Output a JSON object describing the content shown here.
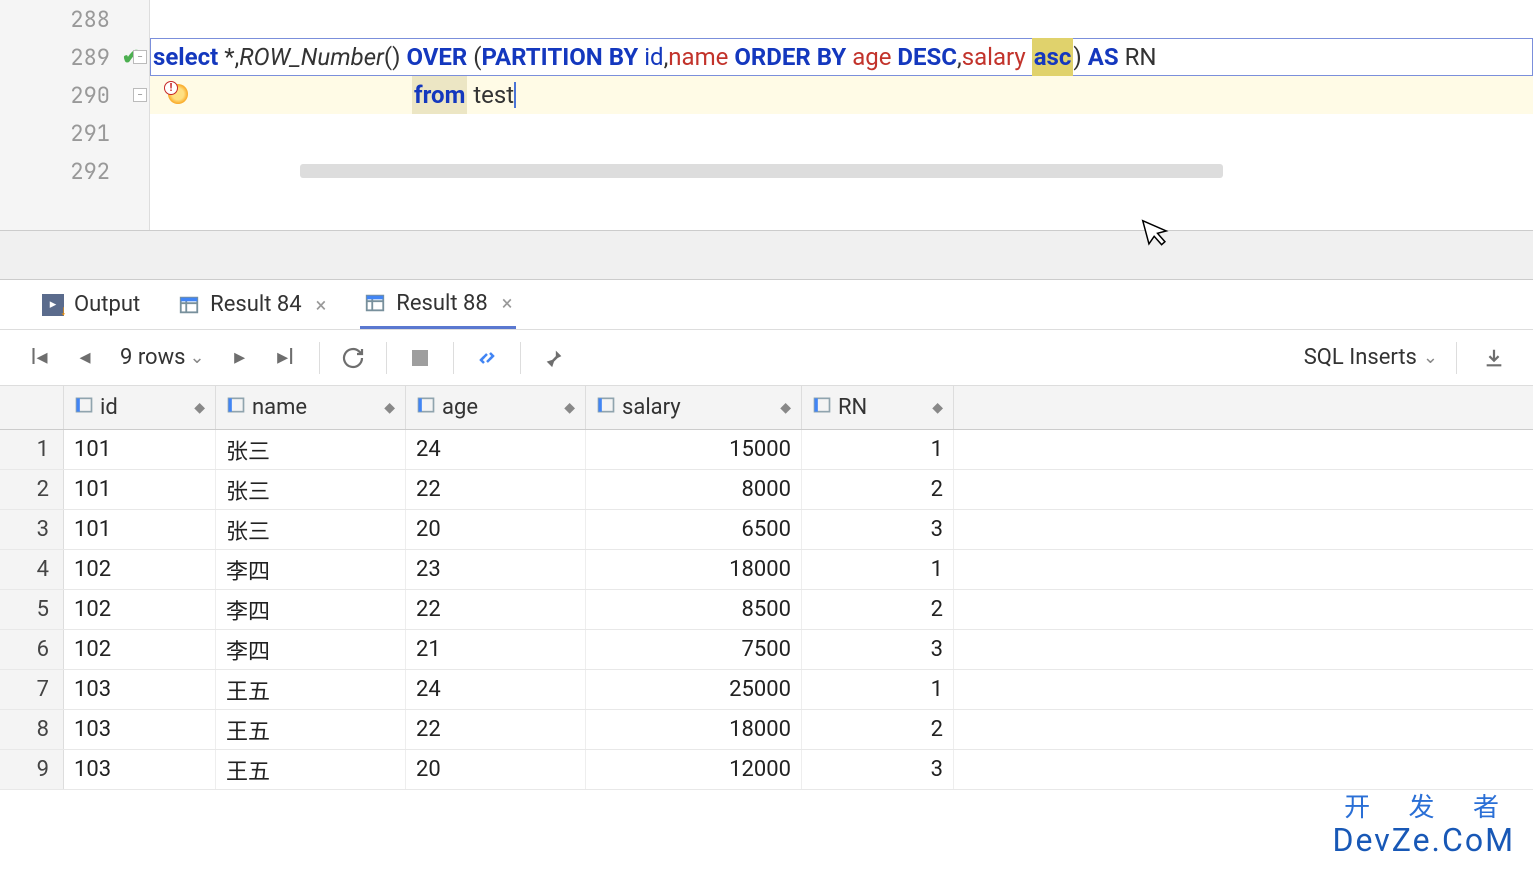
{
  "editor": {
    "lines": [
      "288",
      "289",
      "290",
      "291",
      "292"
    ],
    "code_line1": {
      "t_select": "select",
      "t_star": " *,",
      "t_func": "ROW_Number",
      "t_paren_open": "() ",
      "t_over": "OVER",
      "t_open2": " (",
      "t_partition": "PARTITION BY",
      "t_id": " id",
      "t_comma1": ",",
      "t_name": "name",
      "t_sp1": " ",
      "t_orderby": "ORDER BY",
      "t_age": " age ",
      "t_desc": "DESC",
      "t_comma2": ",",
      "t_salary": "salary",
      "t_sp2": " ",
      "t_asc": "asc",
      "t_close": ") ",
      "t_as": "AS",
      "t_rn": " RN"
    },
    "code_line2": {
      "t_from": "from",
      "t_test": " test"
    }
  },
  "tabs": {
    "output": "Output",
    "result84": "Result 84",
    "result88": "Result 88"
  },
  "toolbar": {
    "rows": "9 rows",
    "export_label": "SQL Inserts"
  },
  "table": {
    "columns": [
      "id",
      "name",
      "age",
      "salary",
      "RN"
    ],
    "rows": [
      {
        "n": "1",
        "id": "101",
        "name": "张三",
        "age": "24",
        "salary": "15000",
        "rn": "1"
      },
      {
        "n": "2",
        "id": "101",
        "name": "张三",
        "age": "22",
        "salary": "8000",
        "rn": "2"
      },
      {
        "n": "3",
        "id": "101",
        "name": "张三",
        "age": "20",
        "salary": "6500",
        "rn": "3"
      },
      {
        "n": "4",
        "id": "102",
        "name": "李四",
        "age": "23",
        "salary": "18000",
        "rn": "1"
      },
      {
        "n": "5",
        "id": "102",
        "name": "李四",
        "age": "22",
        "salary": "8500",
        "rn": "2"
      },
      {
        "n": "6",
        "id": "102",
        "name": "李四",
        "age": "21",
        "salary": "7500",
        "rn": "3"
      },
      {
        "n": "7",
        "id": "103",
        "name": "王五",
        "age": "24",
        "salary": "25000",
        "rn": "1"
      },
      {
        "n": "8",
        "id": "103",
        "name": "王五",
        "age": "22",
        "salary": "18000",
        "rn": "2"
      },
      {
        "n": "9",
        "id": "103",
        "name": "王五",
        "age": "20",
        "salary": "12000",
        "rn": "3"
      }
    ]
  },
  "watermark": {
    "cn": "开 发 者",
    "en": "DevZe.CoM"
  }
}
